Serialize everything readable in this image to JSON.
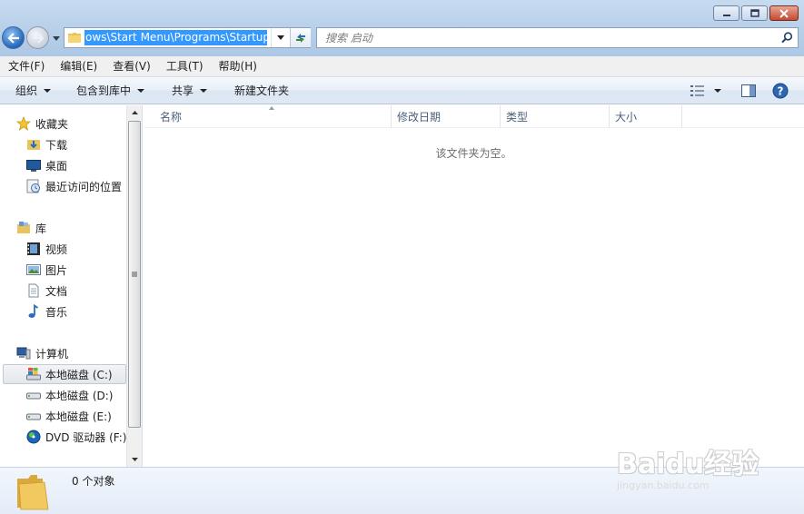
{
  "window": {
    "minimize_label": "–",
    "maximize_label": "□",
    "close_label": "✕"
  },
  "address_bar": {
    "path": "ows\\Start Menu\\Programs\\Startup"
  },
  "search": {
    "placeholder": "搜索 启动"
  },
  "menu": {
    "items": [
      "文件(F)",
      "编辑(E)",
      "查看(V)",
      "工具(T)",
      "帮助(H)"
    ]
  },
  "commands": {
    "organize": "组织",
    "include_in_library": "包含到库中",
    "share": "共享",
    "new_folder": "新建文件夹"
  },
  "nav": {
    "favorites": "收藏夹",
    "downloads": "下载",
    "desktop": "桌面",
    "recent": "最近访问的位置",
    "libraries": "库",
    "videos": "视频",
    "pictures": "图片",
    "documents": "文档",
    "music": "音乐",
    "computer": "计算机",
    "drive_c": "本地磁盘 (C:)",
    "drive_d": "本地磁盘 (D:)",
    "drive_e": "本地磁盘 (E:)",
    "drive_f": "DVD 驱动器 (F:)"
  },
  "columns": {
    "name": "名称",
    "date_modified": "修改日期",
    "type": "类型",
    "size": "大小"
  },
  "content": {
    "empty_message": "该文件夹为空。"
  },
  "details": {
    "item_count": "0 个对象"
  },
  "watermark": {
    "main": "Baidu经验",
    "sub": "jingyan.baidu.com"
  },
  "colors": {
    "selection": "#3399ff",
    "chrome": "#b9d1ea",
    "close_button": "#c44a30"
  }
}
